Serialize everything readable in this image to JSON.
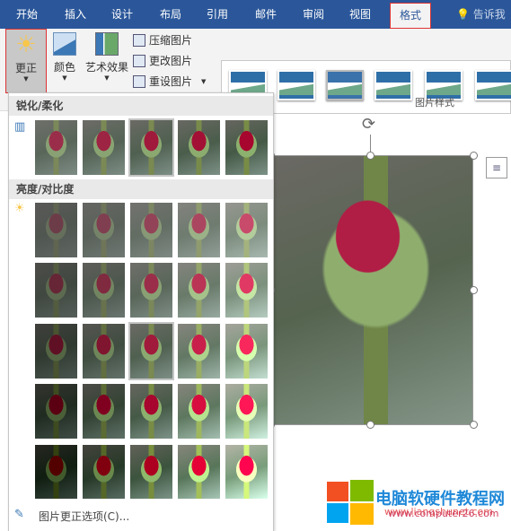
{
  "tabs": [
    "开始",
    "插入",
    "设计",
    "布局",
    "引用",
    "邮件",
    "审阅",
    "视图",
    "格式"
  ],
  "active_tab": "格式",
  "tell_me": "告诉我您",
  "ribbon": {
    "corrections": "更正",
    "color": "颜色",
    "artistic": "艺术效果",
    "compress": "压缩图片",
    "change": "更改图片",
    "reset": "重设图片",
    "styles_group": "图片样式"
  },
  "menu": {
    "sharpen_title": "锐化/柔化",
    "brightness_title": "亮度/对比度",
    "options": "图片更正选项(C)..."
  },
  "watermark": {
    "site_cn": "电脑软硬件教程网",
    "url1": "www.computer26.com",
    "url2": "www.liangshunet.com"
  },
  "colors": {
    "tab_bar": "#2b579a",
    "selection_border": "#d33"
  }
}
